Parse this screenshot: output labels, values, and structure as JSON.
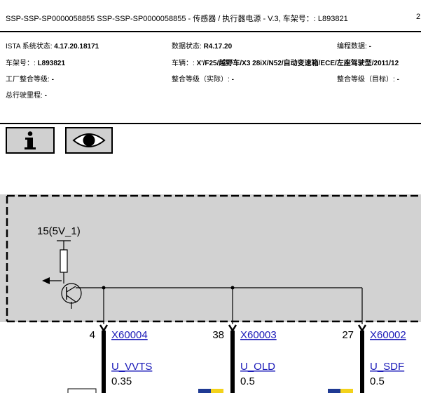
{
  "header": {
    "title": "SSP-SSP-SP0000058855 SSP-SSP-SP0000058855 - 传感器 / 执行器电源 - V.3, 车架号：: L893821",
    "page_number": "2"
  },
  "meta": {
    "ista_label": "ISTA 系统状态:",
    "ista_value": "4.17.20.18171",
    "data_label": "数据状态:",
    "data_value": "R4.17.20",
    "prog_label": "编程数据:",
    "prog_value": "-",
    "vin_label": "车架号：:",
    "vin_value": "L893821",
    "vehicle_label": "车辆：:",
    "vehicle_value": "X'/F25/越野车/X3 28iX/N52/自动变速箱/ECE/左座驾驶型/2011/12",
    "factory_label": "工厂整合等级:",
    "factory_value": "-",
    "actual_label": "整合等级（实际）:",
    "actual_value": "-",
    "target_label": "整合等级（目标）:",
    "target_value": "-",
    "mileage_label": "总行驶里程:",
    "mileage_value": "-"
  },
  "toolbar": {
    "info_icon": "info-icon",
    "view_icon": "eye-icon"
  },
  "diagram": {
    "supply_label": "15(5V_1)",
    "pins": [
      {
        "pin": "4",
        "connector": "X60004",
        "signal": "U_VVTS",
        "size": "0.35"
      },
      {
        "pin": "38",
        "connector": "X60003",
        "signal": "U_OLD",
        "size": "0.5"
      },
      {
        "pin": "27",
        "connector": "X60002",
        "signal": "U_SDF",
        "size": "0.5"
      }
    ]
  },
  "colors": {
    "box_fill": "#d2d2d2",
    "link": "#1a1ab8",
    "wire_accent_blue": "#1f3a93",
    "wire_accent_yellow": "#f3d21b"
  }
}
